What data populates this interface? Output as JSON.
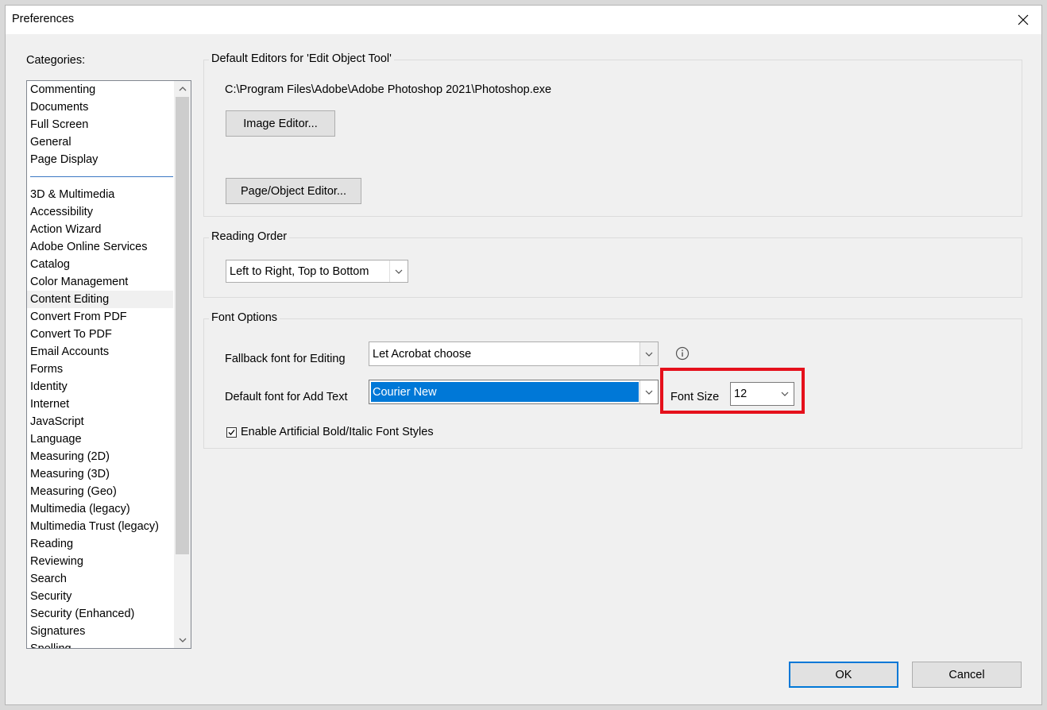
{
  "window": {
    "title": "Preferences"
  },
  "categories": {
    "label": "Categories:",
    "group1": [
      "Commenting",
      "Documents",
      "Full Screen",
      "General",
      "Page Display"
    ],
    "group2": [
      "3D & Multimedia",
      "Accessibility",
      "Action Wizard",
      "Adobe Online Services",
      "Catalog",
      "Color Management",
      "Content Editing",
      "Convert From PDF",
      "Convert To PDF",
      "Email Accounts",
      "Forms",
      "Identity",
      "Internet",
      "JavaScript",
      "Language",
      "Measuring (2D)",
      "Measuring (3D)",
      "Measuring (Geo)",
      "Multimedia (legacy)",
      "Multimedia Trust (legacy)",
      "Reading",
      "Reviewing",
      "Search",
      "Security",
      "Security (Enhanced)",
      "Signatures",
      "Spelling"
    ],
    "selected": "Content Editing"
  },
  "editors": {
    "legend": "Default Editors for 'Edit Object Tool'",
    "path": "C:\\Program Files\\Adobe\\Adobe Photoshop 2021\\Photoshop.exe",
    "image_editor_label": "Image Editor...",
    "page_object_editor_label": "Page/Object Editor..."
  },
  "reading_order": {
    "legend": "Reading Order",
    "value": "Left to Right, Top to Bottom"
  },
  "font_options": {
    "legend": "Font Options",
    "fallback_label": "Fallback font for Editing",
    "fallback_value": "Let Acrobat choose",
    "default_label": "Default font for Add Text",
    "default_value": "Courier New",
    "font_size_label": "Font Size",
    "font_size_value": "12",
    "artificial_label": "Enable Artificial Bold/Italic Font Styles",
    "artificial_checked": true
  },
  "footer": {
    "ok_label": "OK",
    "cancel_label": "Cancel"
  },
  "colors": {
    "accent": "#0078d7",
    "highlight": "#e5101b",
    "separator": "#3c78c3"
  },
  "icons": {
    "close": "close-icon",
    "info": "info-icon",
    "chevron": "chevron-down-icon",
    "check": "checkmark-icon"
  }
}
